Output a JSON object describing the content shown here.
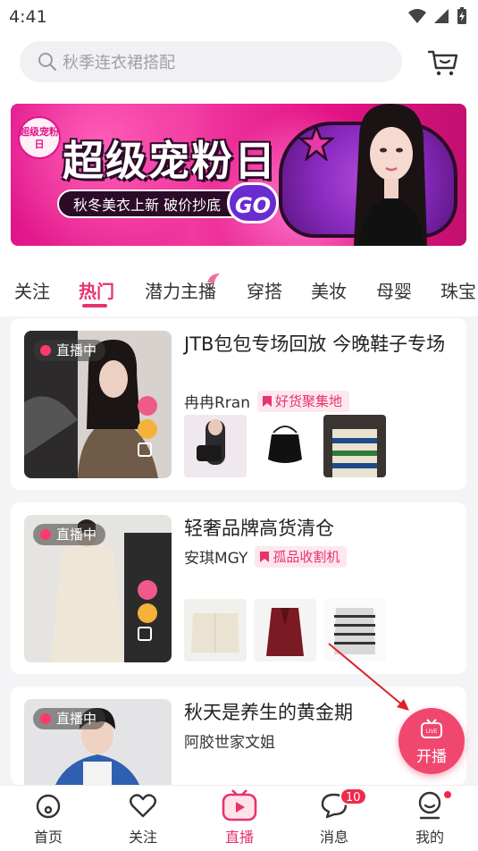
{
  "status_bar": {
    "time": "4:41"
  },
  "search": {
    "placeholder": "秋季连衣裙搭配"
  },
  "banner": {
    "logo_text": "超级宠粉日",
    "title": "超级宠粉日",
    "subtitle": "秋冬美衣上新 破价抄底",
    "cta": "GO"
  },
  "tabs": [
    "关注",
    "热门",
    "潜力主播",
    "穿搭",
    "美妆",
    "母婴",
    "珠宝"
  ],
  "active_tab": "热门",
  "live_label": "直播中",
  "cards": [
    {
      "title": "JTB包包专场回放 今晚鞋子专场",
      "host": "冉冉Rran",
      "tag": "好货聚集地",
      "products": 3
    },
    {
      "title": "轻奢品牌高货清仓",
      "host": "安琪MGY",
      "tag": "孤品收割机",
      "products": 3
    },
    {
      "title": "秋天是养生的黄金期",
      "host": "阿胶世家文姐",
      "tag": "",
      "products": 0
    }
  ],
  "fab": {
    "icon_text": "LIVE",
    "label": "开播"
  },
  "bottom_nav": [
    {
      "label": "首页",
      "icon": "home-icon"
    },
    {
      "label": "关注",
      "icon": "heart-icon"
    },
    {
      "label": "直播",
      "icon": "tv-icon",
      "active": true
    },
    {
      "label": "消息",
      "icon": "chat-icon",
      "badge": "10"
    },
    {
      "label": "我的",
      "icon": "profile-icon",
      "dot": true
    }
  ],
  "colors": {
    "accent": "#e8336d",
    "banner": "#e1158a"
  }
}
